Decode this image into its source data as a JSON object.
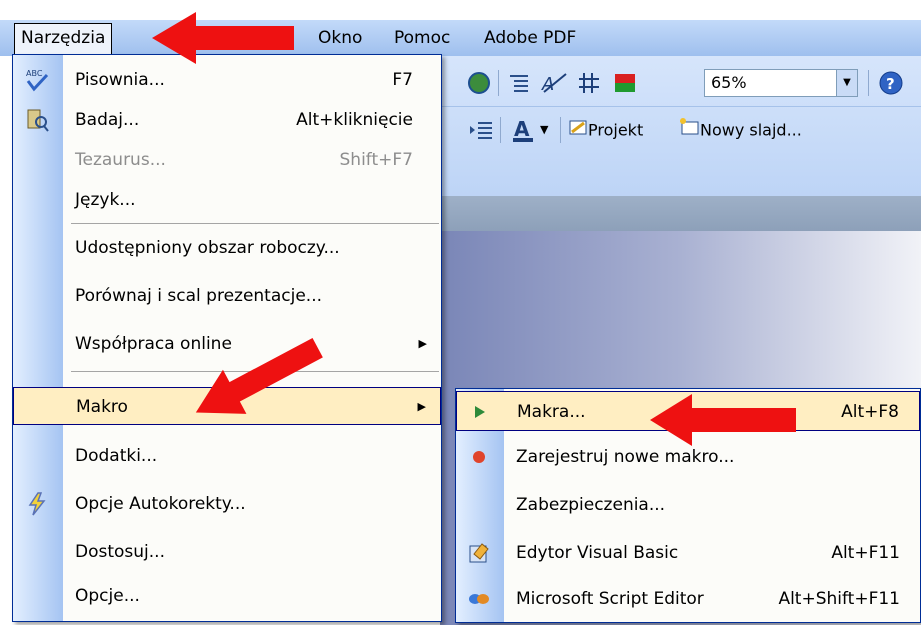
{
  "menubar": {
    "items": [
      {
        "label": "Narzędzia",
        "active": true
      },
      {
        "label": "Okno"
      },
      {
        "label": "Pomoc"
      },
      {
        "label": "Adobe PDF"
      }
    ]
  },
  "toolbar": {
    "zoom": "65%",
    "projekt_label": "Projekt",
    "nowy_slajd_label": "Nowy slajd..."
  },
  "menu": {
    "items": [
      {
        "label": "Pisownia...",
        "shortcut": "F7",
        "icon": "spellcheck-icon"
      },
      {
        "label": "Badaj...",
        "shortcut": "Alt+kliknięcie",
        "icon": "research-icon"
      },
      {
        "label": "Tezaurus...",
        "shortcut": "Shift+F7",
        "disabled": true
      },
      {
        "label": "Język..."
      },
      {
        "label": "Udostępniony obszar roboczy..."
      },
      {
        "label": "Porównaj i scal prezentacje..."
      },
      {
        "label": "Współpraca online",
        "submenu": true
      },
      {
        "label": "Makro",
        "submenu": true,
        "highlighted": true
      },
      {
        "label": "Dodatki..."
      },
      {
        "label": "Opcje Autokorekty...",
        "icon": "autocorrect-icon"
      },
      {
        "label": "Dostosuj..."
      },
      {
        "label": "Opcje..."
      }
    ]
  },
  "submenu": {
    "items": [
      {
        "label": "Makra...",
        "shortcut": "Alt+F8",
        "icon": "run-macro-icon",
        "highlighted": true
      },
      {
        "label": "Zarejestruj nowe makro...",
        "icon": "record-icon"
      },
      {
        "label": "Zabezpieczenia..."
      },
      {
        "label": "Edytor Visual Basic",
        "shortcut": "Alt+F11",
        "icon": "vba-editor-icon"
      },
      {
        "label": "Microsoft Script Editor",
        "shortcut": "Alt+Shift+F11",
        "icon": "script-editor-icon"
      }
    ]
  },
  "colors": {
    "highlight": "#ffeec2",
    "menu_border": "#002d96",
    "arrow": "#ee1111"
  }
}
